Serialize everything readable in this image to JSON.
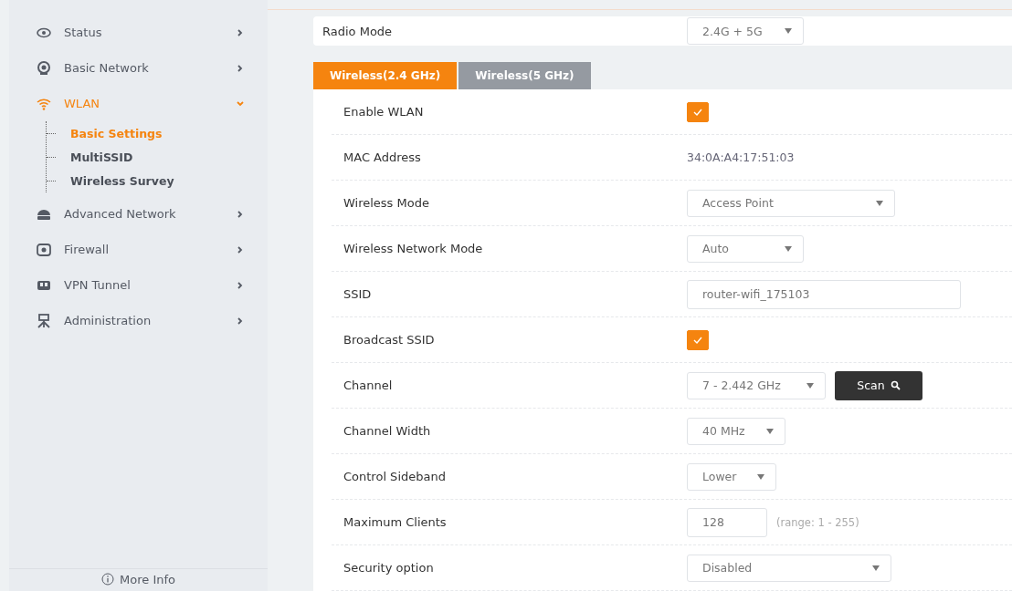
{
  "sidebar": {
    "items": [
      {
        "label": "Status",
        "expanded": false,
        "selected": false
      },
      {
        "label": "Basic Network",
        "expanded": false,
        "selected": false
      },
      {
        "label": "WLAN",
        "expanded": true,
        "selected": true,
        "children": [
          {
            "label": "Basic Settings",
            "selected": true
          },
          {
            "label": "MultiSSID",
            "selected": false
          },
          {
            "label": "Wireless Survey",
            "selected": false
          }
        ]
      },
      {
        "label": "Advanced Network",
        "expanded": false,
        "selected": false
      },
      {
        "label": "Firewall",
        "expanded": false,
        "selected": false
      },
      {
        "label": "VPN Tunnel",
        "expanded": false,
        "selected": false
      },
      {
        "label": "Administration",
        "expanded": false,
        "selected": false
      }
    ],
    "footer": "More Info"
  },
  "radio_mode": {
    "label": "Radio Mode",
    "value": "2.4G + 5G"
  },
  "tabs": [
    {
      "label": "Wireless(2.4 GHz)",
      "selected": true
    },
    {
      "label": "Wireless(5 GHz)",
      "selected": false
    }
  ],
  "rows": [
    {
      "kind": "checkbox",
      "label": "Enable WLAN",
      "checked": true
    },
    {
      "kind": "text",
      "label": "MAC Address",
      "value": "34:0A:A4:17:51:03"
    },
    {
      "kind": "select",
      "label": "Wireless Mode",
      "value": "Access Point"
    },
    {
      "kind": "select",
      "label": "Wireless Network Mode",
      "value": "Auto"
    },
    {
      "kind": "input",
      "label": "SSID",
      "value": "router-wifi_175103"
    },
    {
      "kind": "checkbox",
      "label": "Broadcast SSID",
      "checked": true
    },
    {
      "kind": "select",
      "label": "Channel",
      "value": "7 - 2.442 GHz",
      "button": "Scan"
    },
    {
      "kind": "select",
      "label": "Channel Width",
      "value": "40 MHz"
    },
    {
      "kind": "select",
      "label": "Control Sideband",
      "value": "Lower"
    },
    {
      "kind": "input",
      "label": "Maximum Clients",
      "value": "128",
      "hint": "(range: 1 - 255)"
    },
    {
      "kind": "select",
      "label": "Security option",
      "value": "Disabled"
    }
  ]
}
